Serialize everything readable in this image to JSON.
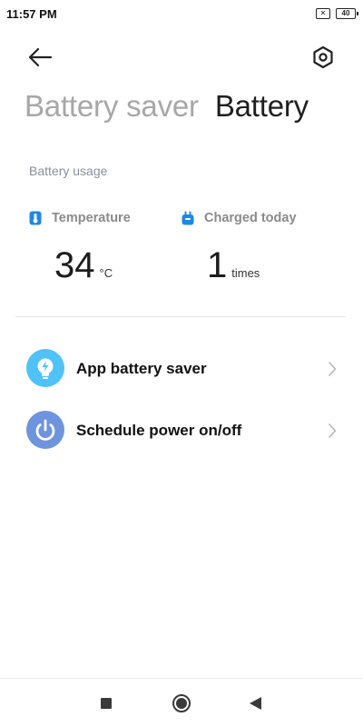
{
  "status": {
    "time": "11:57 PM",
    "sim_label": "✕",
    "battery_level": "40"
  },
  "tabs": [
    {
      "label": "Battery saver",
      "active": false
    },
    {
      "label": "Battery",
      "active": true
    }
  ],
  "battery_usage": {
    "section_label": "Battery usage",
    "temperature": {
      "title": "Temperature",
      "value": "34",
      "unit": "°C",
      "icon": "thermometer-icon"
    },
    "charged": {
      "title": "Charged today",
      "value": "1",
      "unit": "times",
      "icon": "plug-icon"
    }
  },
  "list": [
    {
      "label": "App battery saver",
      "icon": "lightning-bulb-icon"
    },
    {
      "label": "Schedule power on/off",
      "icon": "power-icon"
    }
  ],
  "colors": {
    "accent_blue": "#1e88e5",
    "app_saver_icon_bg": "#4fc3f7",
    "schedule_icon_bg": "#6f94de"
  }
}
